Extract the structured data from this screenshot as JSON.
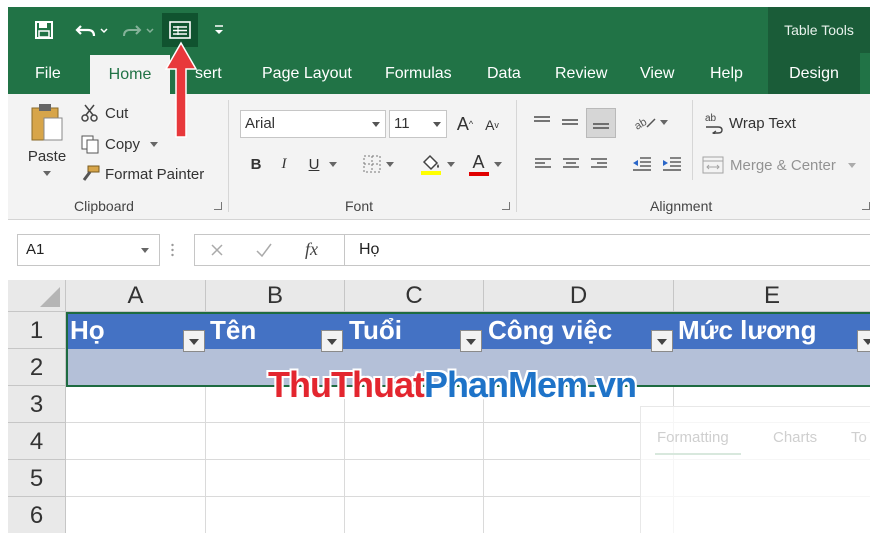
{
  "titlebar": {
    "context_tab_group": "Table Tools"
  },
  "tabs": [
    "File",
    "Home",
    "Insert",
    "Page Layout",
    "Formulas",
    "Data",
    "Review",
    "View",
    "Help",
    "Design"
  ],
  "visible_tab_text": {
    "insert_partial": "sert"
  },
  "clipboard": {
    "paste": "Paste",
    "cut": "Cut",
    "copy": "Copy",
    "format_painter": "Format Painter",
    "group_label": "Clipboard"
  },
  "font": {
    "name": "Arial",
    "size": "11",
    "bold": "B",
    "italic": "I",
    "underline": "U",
    "grow": "A",
    "shrink": "A",
    "font_color_glyph": "A",
    "group_label": "Font"
  },
  "alignment": {
    "wrap_text": "Wrap Text",
    "merge_center": "Merge & Center",
    "group_label": "Alignment"
  },
  "formula_bar": {
    "name_box": "A1",
    "fx": "fx",
    "value": "Họ"
  },
  "columns": [
    "A",
    "B",
    "C",
    "D",
    "E"
  ],
  "rows": [
    "1",
    "2",
    "3",
    "4",
    "5",
    "6"
  ],
  "table_headers": [
    "Họ",
    "Tên",
    "Tuổi",
    "Công việc",
    "Mức lương"
  ],
  "watermark": {
    "part1": "ThuThuat",
    "part2": "PhanMem.vn"
  },
  "quick_analysis_ghost": {
    "tabs": [
      "Formatting",
      "Charts",
      "To"
    ]
  },
  "colors": {
    "excel_green": "#217346",
    "table_header": "#4472c4",
    "table_band": "#b4c0d8",
    "arrow": "#e8383b"
  }
}
